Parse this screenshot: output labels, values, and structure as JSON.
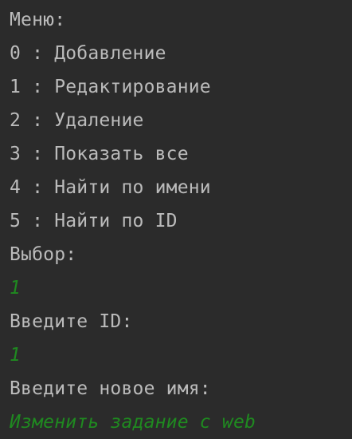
{
  "console": {
    "colors": {
      "background": "#2b2b2b",
      "output_text": "#bbbbbb",
      "user_input": "#1f8a20"
    },
    "lines": [
      {
        "text": "Меню:",
        "kind": "output"
      },
      {
        "text": "0 : Добавление",
        "kind": "output"
      },
      {
        "text": "1 : Редактирование",
        "kind": "output"
      },
      {
        "text": "2 : Удаление",
        "kind": "output"
      },
      {
        "text": "3 : Показать все",
        "kind": "output"
      },
      {
        "text": "4 : Найти по имени",
        "kind": "output"
      },
      {
        "text": "5 : Найти по ID",
        "kind": "output"
      },
      {
        "text": "Выбор:",
        "kind": "output"
      },
      {
        "text": "1",
        "kind": "input"
      },
      {
        "text": "Введите ID:",
        "kind": "output"
      },
      {
        "text": "1",
        "kind": "input"
      },
      {
        "text": "Введите новое имя:",
        "kind": "output"
      },
      {
        "text": "Изменить задание с web",
        "kind": "input"
      }
    ]
  }
}
